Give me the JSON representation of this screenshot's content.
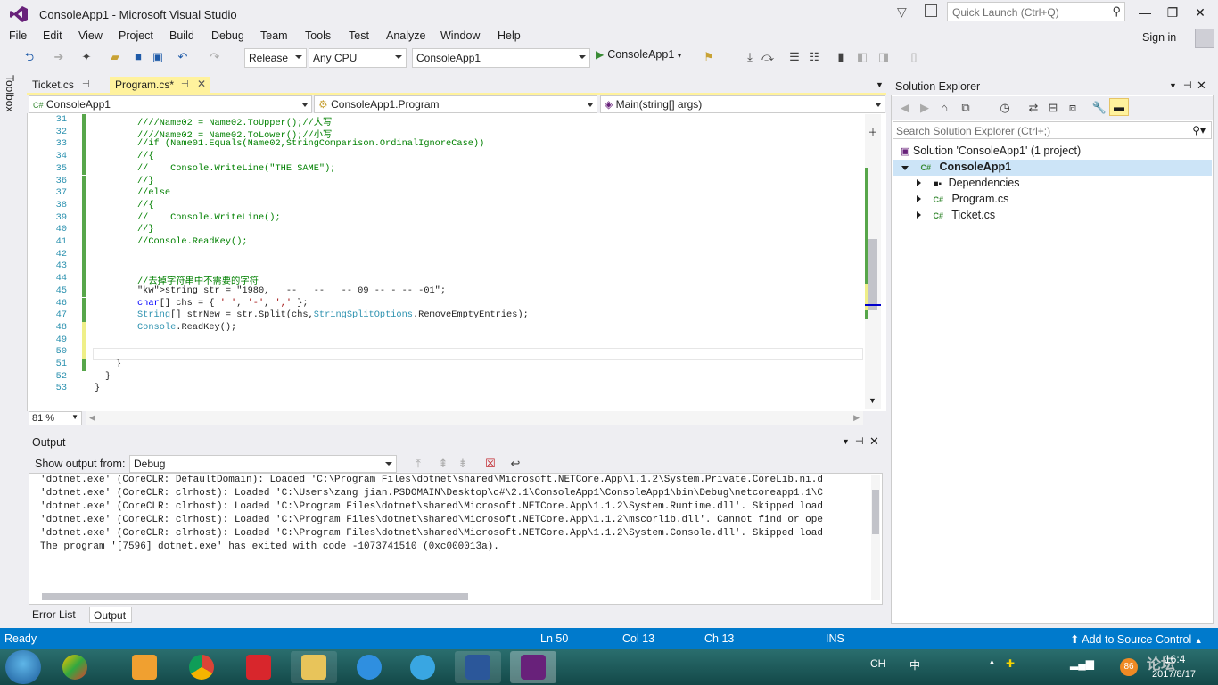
{
  "window": {
    "title": "ConsoleApp1 - Microsoft Visual Studio",
    "quick_launch_placeholder": "Quick Launch (Ctrl+Q)"
  },
  "menu": [
    "File",
    "Edit",
    "View",
    "Project",
    "Build",
    "Debug",
    "Team",
    "Tools",
    "Test",
    "Analyze",
    "Window",
    "Help"
  ],
  "sign_in": "Sign in",
  "toolbar": {
    "config": "Release",
    "platform": "Any CPU",
    "startup_project": "ConsoleApp1",
    "run_label": "ConsoleApp1"
  },
  "toolbox_label": "Toolbox",
  "tabs": [
    {
      "label": "Ticket.cs",
      "active": false
    },
    {
      "label": "Program.cs*",
      "active": true
    }
  ],
  "navbar": {
    "project": "ConsoleApp1",
    "class": "ConsoleApp1.Program",
    "member": "Main(string[] args)"
  },
  "code_lines": [
    {
      "n": "31",
      "t": "////Name02 = Name02.ToUpper();//大写",
      "k": "cm",
      "indent": 2
    },
    {
      "n": "32",
      "t": "////Name02 = Name02.ToLower();//小写",
      "k": "cm",
      "indent": 2
    },
    {
      "n": "33",
      "t": "//if (Name01.Equals(Name02,StringComparison.OrdinalIgnoreCase))",
      "k": "cm",
      "indent": 2
    },
    {
      "n": "34",
      "t": "//{",
      "k": "cm",
      "indent": 2
    },
    {
      "n": "35",
      "t": "//    Console.WriteLine(\"THE SAME\");",
      "k": "cm",
      "indent": 2
    },
    {
      "n": "36",
      "t": "//}",
      "k": "cm",
      "indent": 2
    },
    {
      "n": "37",
      "t": "//else",
      "k": "cm",
      "indent": 2
    },
    {
      "n": "38",
      "t": "//{",
      "k": "cm",
      "indent": 2
    },
    {
      "n": "39",
      "t": "//    Console.WriteLine();",
      "k": "cm",
      "indent": 2
    },
    {
      "n": "40",
      "t": "//}",
      "k": "cm",
      "indent": 2
    },
    {
      "n": "41",
      "t": "//Console.ReadKey();",
      "k": "cm",
      "indent": 2
    },
    {
      "n": "42",
      "t": "",
      "k": "",
      "indent": 2
    },
    {
      "n": "43",
      "t": "",
      "k": "",
      "indent": 2
    },
    {
      "n": "44",
      "t": "//去掉字符串中不需要的字符",
      "k": "cm",
      "indent": 2
    },
    {
      "n": "45",
      "t": "string str = \"1980,   --   --   -- 09 -- - -- -01\";",
      "k": "mix1",
      "indent": 2
    },
    {
      "n": "46",
      "t": "char[] chs = { ' ', '-', ',' };",
      "k": "mix2",
      "indent": 2
    },
    {
      "n": "47",
      "t": "String[] strNew = str.Split(chs,StringSplitOptions.RemoveEmptyEntries);",
      "k": "mix3",
      "indent": 2
    },
    {
      "n": "48",
      "t": "Console.ReadKey();",
      "k": "mix4",
      "indent": 2
    },
    {
      "n": "49",
      "t": "",
      "k": "",
      "indent": 2
    },
    {
      "n": "50",
      "t": "",
      "k": "",
      "indent": 2
    },
    {
      "n": "51",
      "t": "}",
      "k": "",
      "indent": 1
    },
    {
      "n": "52",
      "t": "}",
      "k": "",
      "indent": 0.5
    },
    {
      "n": "53",
      "t": "}",
      "k": "",
      "indent": 0
    }
  ],
  "zoom": "81 %",
  "output": {
    "title": "Output",
    "show_from_label": "Show output from:",
    "source": "Debug",
    "lines": [
      "'dotnet.exe' (CoreCLR: DefaultDomain): Loaded 'C:\\Program Files\\dotnet\\shared\\Microsoft.NETCore.App\\1.1.2\\System.Private.CoreLib.ni.d",
      "'dotnet.exe' (CoreCLR: clrhost): Loaded 'C:\\Users\\zang jian.PSDOMAIN\\Desktop\\c#\\2.1\\ConsoleApp1\\ConsoleApp1\\bin\\Debug\\netcoreapp1.1\\C",
      "'dotnet.exe' (CoreCLR: clrhost): Loaded 'C:\\Program Files\\dotnet\\shared\\Microsoft.NETCore.App\\1.1.2\\System.Runtime.dll'. Skipped load",
      "'dotnet.exe' (CoreCLR: clrhost): Loaded 'C:\\Program Files\\dotnet\\shared\\Microsoft.NETCore.App\\1.1.2\\mscorlib.dll'. Cannot find or ope",
      "'dotnet.exe' (CoreCLR: clrhost): Loaded 'C:\\Program Files\\dotnet\\shared\\Microsoft.NETCore.App\\1.1.2\\System.Console.dll'. Skipped load",
      "The program '[7596] dotnet.exe' has exited with code -1073741510 (0xc000013a)."
    ]
  },
  "bottom_tabs": [
    "Error List ...",
    "Output"
  ],
  "solution_explorer": {
    "title": "Solution Explorer",
    "search_placeholder": "Search Solution Explorer (Ctrl+;)",
    "solution": "Solution 'ConsoleApp1' (1 project)",
    "project": "ConsoleApp1",
    "items": [
      "Dependencies",
      "Program.cs",
      "Ticket.cs"
    ]
  },
  "status": {
    "ready": "Ready",
    "ln": "Ln 50",
    "col": "Col 13",
    "ch": "Ch 13",
    "ins": "INS",
    "source_control": "Add to Source Control"
  },
  "taskbar": {
    "lang": "CH",
    "ime": "中",
    "badge": "86",
    "watermark": "论坛",
    "time": "16:4",
    "date": "2017/8/17"
  },
  "colors": {
    "accent": "#007acc",
    "active_tab": "#fff29d",
    "comment": "#008000",
    "keyword": "#0000ff",
    "type": "#2b91af",
    "string": "#a31515"
  }
}
